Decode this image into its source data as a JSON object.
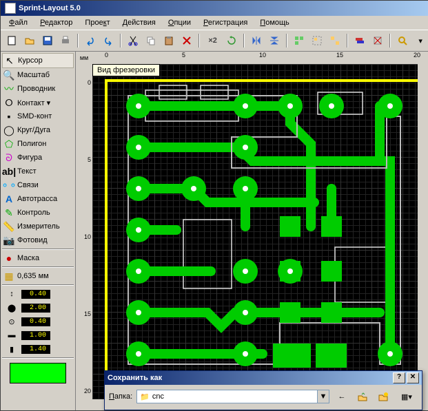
{
  "title": "Sprint-Layout 5.0",
  "menu": [
    "Файл",
    "Редактор",
    "Проект",
    "Действия",
    "Опции",
    "Регистрация",
    "Помощь"
  ],
  "tools": [
    {
      "icon": "cursor",
      "label": "Курсор",
      "sel": true
    },
    {
      "icon": "zoom",
      "label": "Масштаб"
    },
    {
      "icon": "track",
      "label": "Проводник"
    },
    {
      "icon": "pad",
      "label": "Контакт ▾"
    },
    {
      "icon": "smd",
      "label": "SMD-конт"
    },
    {
      "icon": "circle",
      "label": "Круг/Дуга"
    },
    {
      "icon": "poly",
      "label": "Полигон"
    },
    {
      "icon": "shape",
      "label": "Фигура"
    },
    {
      "icon": "text",
      "label": "Текст"
    },
    {
      "icon": "link",
      "label": "Связи"
    },
    {
      "icon": "auto",
      "label": "Автотрасса"
    },
    {
      "icon": "check",
      "label": "Контроль"
    },
    {
      "icon": "meas",
      "label": "Измеритель"
    },
    {
      "icon": "photo",
      "label": "Фотовид"
    },
    {
      "icon": "mask",
      "label": "Маска"
    }
  ],
  "grid_label": "0,635 мм",
  "dims": {
    "trace": "0.40",
    "pad_out": "2.00",
    "pad_in": "0.40",
    "smd_w": "1.00",
    "smd_h": "1.40"
  },
  "ruler_unit": "мм",
  "ruler_h": [
    "0",
    "5",
    "10",
    "15",
    "20"
  ],
  "ruler_v": [
    "0",
    "5",
    "10",
    "15",
    "20"
  ],
  "tooltip": "Вид фрезеровки",
  "dialog": {
    "title": "Сохранить как",
    "folder_label": "Папка:",
    "folder_value": "cnc"
  },
  "x2_label": "×2"
}
